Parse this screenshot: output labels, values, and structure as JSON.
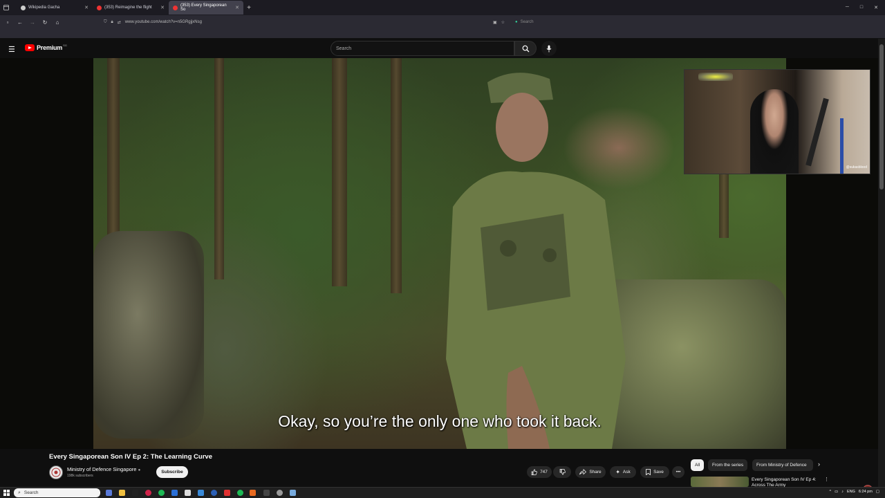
{
  "browser": {
    "tabs": [
      {
        "label": "Wikipedia Gacha",
        "active": false
      },
      {
        "label": "(353) Reimagine the flight",
        "active": false
      },
      {
        "label": "(353) Every Singaporean So",
        "active": true
      }
    ],
    "url": "www.youtube.com/watch?v=n5GRgjjxNsg",
    "search_placeholder": "Search"
  },
  "youtube": {
    "brand": "Premium",
    "country_code": "SG",
    "search_placeholder": "Search"
  },
  "video": {
    "caption": "Okay, so you’re the only one who took it back.",
    "title": "Every Singaporean Son IV Ep 2: The Learning Curve",
    "channel": "Ministry of Defence Singapore",
    "subscribers": "198k subscribers",
    "subscribe_label": "Subscribe",
    "likes": "747",
    "share_label": "Share",
    "ask_label": "Ask",
    "save_label": "Save"
  },
  "webcam": {
    "handle": "@sukasblood"
  },
  "sidebar": {
    "chips": [
      {
        "label": "All",
        "selected": true
      },
      {
        "label": "From the series",
        "selected": false
      },
      {
        "label": "From Ministry of Defence",
        "selected": false
      }
    ],
    "recommendation_title": "Every Singaporean Son IV Ep 4: Across The Army"
  },
  "taskbar": {
    "search_placeholder": "Search",
    "language": "ENG",
    "time": "6:24 pm"
  },
  "colors": {
    "youtube_red": "#ff0000",
    "background": "#0f0f0f"
  }
}
